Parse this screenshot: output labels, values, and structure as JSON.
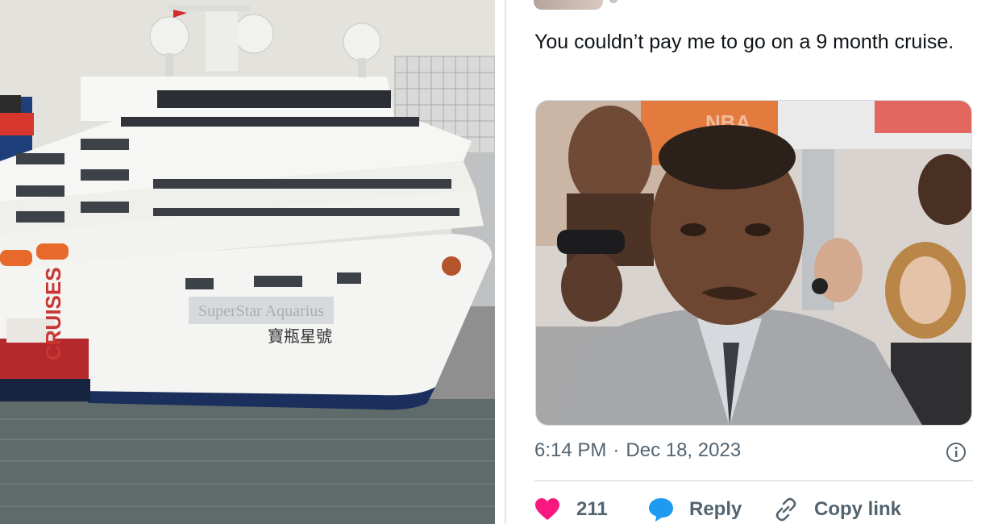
{
  "photo": {
    "ship_hull_text": "寶瓶星號",
    "blurred_name_text": "SuperStar Aquarius",
    "side_text": "CRUISES"
  },
  "tweet": {
    "text": "You couldn’t pay me to go on a 9 month cruise.",
    "time": "6:14 PM",
    "separator": "·",
    "date": "Dec 18, 2023",
    "media": {
      "description_icon": "reaction-meme-image",
      "banner_text": "NBA"
    },
    "actions": {
      "like_count": "211",
      "reply_label": "Reply",
      "copy_label": "Copy link"
    }
  },
  "colors": {
    "like": "#f91880",
    "reply": "#1d9bf0",
    "text": "#0f1419",
    "muted": "#536471"
  }
}
